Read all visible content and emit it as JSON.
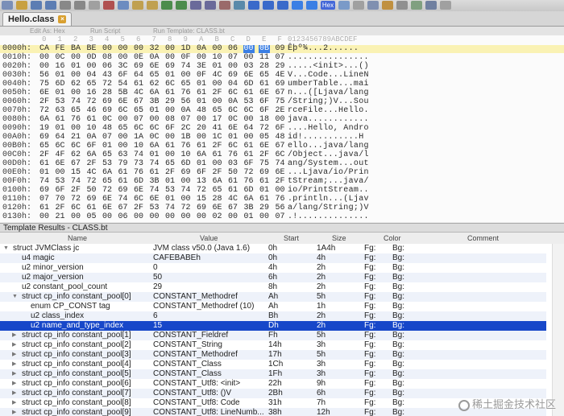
{
  "toolbar": {
    "hex_label": "Hex"
  },
  "tab": {
    "title": "Hello.class"
  },
  "subbar": {
    "edit_as": "Edit As: Hex",
    "run_script": "Run Script",
    "run_template": "Run Template: CLASS.bt"
  },
  "hex": {
    "header_cols": [
      "0",
      "1",
      "2",
      "3",
      "4",
      "5",
      "6",
      "7",
      "8",
      "9",
      "A",
      "B",
      "C",
      "D",
      "E",
      "F"
    ],
    "header_ascii": "0123456789ABCDEF",
    "rows": [
      {
        "addr": "0000h:",
        "bytes": [
          "CA",
          "FE",
          "BA",
          "BE",
          "00",
          "00",
          "00",
          "32",
          "00",
          "1D",
          "0A",
          "00",
          "06",
          "00",
          "0B",
          "09"
        ],
        "ascii": "Êþº¾...2......  "
      },
      {
        "addr": "0010h:",
        "bytes": [
          "00",
          "0C",
          "00",
          "0D",
          "08",
          "00",
          "0E",
          "0A",
          "00",
          "0F",
          "00",
          "10",
          "07",
          "00",
          "11",
          "07"
        ],
        "ascii": "................"
      },
      {
        "addr": "0020h:",
        "bytes": [
          "00",
          "16",
          "01",
          "00",
          "06",
          "3C",
          "69",
          "6E",
          "69",
          "74",
          "3E",
          "01",
          "00",
          "03",
          "28",
          "29"
        ],
        "ascii": ".....<init>...()"
      },
      {
        "addr": "0030h:",
        "bytes": [
          "56",
          "01",
          "00",
          "04",
          "43",
          "6F",
          "64",
          "65",
          "01",
          "00",
          "0F",
          "4C",
          "69",
          "6E",
          "65",
          "4E"
        ],
        "ascii": "V...Code...LineN"
      },
      {
        "addr": "0040h:",
        "bytes": [
          "75",
          "6D",
          "62",
          "65",
          "72",
          "54",
          "61",
          "62",
          "6C",
          "65",
          "01",
          "00",
          "04",
          "6D",
          "61",
          "69"
        ],
        "ascii": "umberTable...mai"
      },
      {
        "addr": "0050h:",
        "bytes": [
          "6E",
          "01",
          "00",
          "16",
          "28",
          "5B",
          "4C",
          "6A",
          "61",
          "76",
          "61",
          "2F",
          "6C",
          "61",
          "6E",
          "67"
        ],
        "ascii": "n...([Ljava/lang"
      },
      {
        "addr": "0060h:",
        "bytes": [
          "2F",
          "53",
          "74",
          "72",
          "69",
          "6E",
          "67",
          "3B",
          "29",
          "56",
          "01",
          "00",
          "0A",
          "53",
          "6F",
          "75"
        ],
        "ascii": "/String;)V...Sou"
      },
      {
        "addr": "0070h:",
        "bytes": [
          "72",
          "63",
          "65",
          "46",
          "69",
          "6C",
          "65",
          "01",
          "00",
          "0A",
          "48",
          "65",
          "6C",
          "6C",
          "6F",
          "2E"
        ],
        "ascii": "rceFile...Hello."
      },
      {
        "addr": "0080h:",
        "bytes": [
          "6A",
          "61",
          "76",
          "61",
          "0C",
          "00",
          "07",
          "00",
          "08",
          "07",
          "00",
          "17",
          "0C",
          "00",
          "18",
          "00"
        ],
        "ascii": "java............"
      },
      {
        "addr": "0090h:",
        "bytes": [
          "19",
          "01",
          "00",
          "10",
          "48",
          "65",
          "6C",
          "6C",
          "6F",
          "2C",
          "20",
          "41",
          "6E",
          "64",
          "72",
          "6F"
        ],
        "ascii": "....Hello, Andro"
      },
      {
        "addr": "00A0h:",
        "bytes": [
          "69",
          "64",
          "21",
          "0A",
          "07",
          "00",
          "1A",
          "0C",
          "00",
          "1B",
          "00",
          "1C",
          "01",
          "00",
          "05",
          "48"
        ],
        "ascii": "id!...........H"
      },
      {
        "addr": "00B0h:",
        "bytes": [
          "65",
          "6C",
          "6C",
          "6F",
          "01",
          "00",
          "10",
          "6A",
          "61",
          "76",
          "61",
          "2F",
          "6C",
          "61",
          "6E",
          "67"
        ],
        "ascii": "ello...java/lang"
      },
      {
        "addr": "00C0h:",
        "bytes": [
          "2F",
          "4F",
          "62",
          "6A",
          "65",
          "63",
          "74",
          "01",
          "00",
          "10",
          "6A",
          "61",
          "76",
          "61",
          "2F",
          "6C"
        ],
        "ascii": "/Object...java/l"
      },
      {
        "addr": "00D0h:",
        "bytes": [
          "61",
          "6E",
          "67",
          "2F",
          "53",
          "79",
          "73",
          "74",
          "65",
          "6D",
          "01",
          "00",
          "03",
          "6F",
          "75",
          "74"
        ],
        "ascii": "ang/System...out"
      },
      {
        "addr": "00E0h:",
        "bytes": [
          "01",
          "00",
          "15",
          "4C",
          "6A",
          "61",
          "76",
          "61",
          "2F",
          "69",
          "6F",
          "2F",
          "50",
          "72",
          "69",
          "6E"
        ],
        "ascii": "...Ljava/io/Prin"
      },
      {
        "addr": "00F0h:",
        "bytes": [
          "74",
          "53",
          "74",
          "72",
          "65",
          "61",
          "6D",
          "3B",
          "01",
          "00",
          "13",
          "6A",
          "61",
          "76",
          "61",
          "2F"
        ],
        "ascii": "tStream;...java/"
      },
      {
        "addr": "0100h:",
        "bytes": [
          "69",
          "6F",
          "2F",
          "50",
          "72",
          "69",
          "6E",
          "74",
          "53",
          "74",
          "72",
          "65",
          "61",
          "6D",
          "01",
          "00"
        ],
        "ascii": "io/PrintStream.."
      },
      {
        "addr": "0110h:",
        "bytes": [
          "07",
          "70",
          "72",
          "69",
          "6E",
          "74",
          "6C",
          "6E",
          "01",
          "00",
          "15",
          "28",
          "4C",
          "6A",
          "61",
          "76"
        ],
        "ascii": ".println...(Ljav"
      },
      {
        "addr": "0120h:",
        "bytes": [
          "61",
          "2F",
          "6C",
          "61",
          "6E",
          "67",
          "2F",
          "53",
          "74",
          "72",
          "69",
          "6E",
          "67",
          "3B",
          "29",
          "56"
        ],
        "ascii": "a/lang/String;)V"
      },
      {
        "addr": "0130h:",
        "bytes": [
          "00",
          "21",
          "00",
          "05",
          "00",
          "06",
          "00",
          "00",
          "00",
          "00",
          "00",
          "02",
          "00",
          "01",
          "00",
          "07"
        ],
        "ascii": ".!.............."
      }
    ]
  },
  "template": {
    "title": "Template Results - CLASS.bt",
    "columns": {
      "name": "Name",
      "value": "Value",
      "start": "Start",
      "size": "Size",
      "color": "Color",
      "comment": "Comment"
    },
    "rows": [
      {
        "name": "struct JVMClass jc",
        "value": "JVM class v50.0 (Java 1.6)",
        "start": "0h",
        "size": "1A4h",
        "fg": "Fg:",
        "bg": "Bg:",
        "indent": 0,
        "tri": "▼"
      },
      {
        "name": "u4 magic",
        "value": "CAFEBABEh",
        "start": "0h",
        "size": "4h",
        "fg": "Fg:",
        "bg": "Bg:",
        "indent": 1,
        "tri": ""
      },
      {
        "name": "u2 minor_version",
        "value": "0",
        "start": "4h",
        "size": "2h",
        "fg": "Fg:",
        "bg": "Bg:",
        "indent": 1,
        "tri": ""
      },
      {
        "name": "u2 major_version",
        "value": "50",
        "start": "6h",
        "size": "2h",
        "fg": "Fg:",
        "bg": "Bg:",
        "indent": 1,
        "tri": ""
      },
      {
        "name": "u2 constant_pool_count",
        "value": "29",
        "start": "8h",
        "size": "2h",
        "fg": "Fg:",
        "bg": "Bg:",
        "indent": 1,
        "tri": ""
      },
      {
        "name": "struct cp_info constant_pool[0]",
        "value": "CONSTANT_Methodref",
        "start": "Ah",
        "size": "5h",
        "fg": "Fg:",
        "bg": "Bg:",
        "indent": 1,
        "tri": "▼"
      },
      {
        "name": "enum CP_CONST tag",
        "value": "CONSTANT_Methodref (10)",
        "start": "Ah",
        "size": "1h",
        "fg": "Fg:",
        "bg": "Bg:",
        "indent": 2,
        "tri": ""
      },
      {
        "name": "u2 class_index",
        "value": "6",
        "start": "Bh",
        "size": "2h",
        "fg": "Fg:",
        "bg": "Bg:",
        "indent": 2,
        "tri": ""
      },
      {
        "name": "u2 name_and_type_index",
        "value": "15",
        "start": "Dh",
        "size": "2h",
        "fg": "Fg:",
        "bg": "Bg:",
        "indent": 2,
        "tri": "",
        "selected": true
      },
      {
        "name": "struct cp_info constant_pool[1]",
        "value": "CONSTANT_Fieldref",
        "start": "Fh",
        "size": "5h",
        "fg": "Fg:",
        "bg": "Bg:",
        "indent": 1,
        "tri": "▶"
      },
      {
        "name": "struct cp_info constant_pool[2]",
        "value": "CONSTANT_String",
        "start": "14h",
        "size": "3h",
        "fg": "Fg:",
        "bg": "Bg:",
        "indent": 1,
        "tri": "▶"
      },
      {
        "name": "struct cp_info constant_pool[3]",
        "value": "CONSTANT_Methodref",
        "start": "17h",
        "size": "5h",
        "fg": "Fg:",
        "bg": "Bg:",
        "indent": 1,
        "tri": "▶"
      },
      {
        "name": "struct cp_info constant_pool[4]",
        "value": "CONSTANT_Class",
        "start": "1Ch",
        "size": "3h",
        "fg": "Fg:",
        "bg": "Bg:",
        "indent": 1,
        "tri": "▶"
      },
      {
        "name": "struct cp_info constant_pool[5]",
        "value": "CONSTANT_Class",
        "start": "1Fh",
        "size": "3h",
        "fg": "Fg:",
        "bg": "Bg:",
        "indent": 1,
        "tri": "▶"
      },
      {
        "name": "struct cp_info constant_pool[6]",
        "value": "CONSTANT_Utf8: <init>",
        "start": "22h",
        "size": "9h",
        "fg": "Fg:",
        "bg": "Bg:",
        "indent": 1,
        "tri": "▶"
      },
      {
        "name": "struct cp_info constant_pool[7]",
        "value": "CONSTANT_Utf8: ()V",
        "start": "2Bh",
        "size": "6h",
        "fg": "Fg:",
        "bg": "Bg:",
        "indent": 1,
        "tri": "▶"
      },
      {
        "name": "struct cp_info constant_pool[8]",
        "value": "CONSTANT_Utf8: Code",
        "start": "31h",
        "size": "7h",
        "fg": "Fg:",
        "bg": "Bg:",
        "indent": 1,
        "tri": "▶"
      },
      {
        "name": "struct cp_info constant_pool[9]",
        "value": "CONSTANT_Utf8: LineNumb...",
        "start": "38h",
        "size": "12h",
        "fg": "Fg:",
        "bg": "Bg:",
        "indent": 1,
        "tri": "▶"
      }
    ]
  },
  "watermark": {
    "text": "稀土掘金技术社区"
  },
  "colors": {
    "selection": "#1747c9",
    "hex_highlight": "#3b7fe4",
    "hex_row_highlight": "#faf2b4"
  }
}
